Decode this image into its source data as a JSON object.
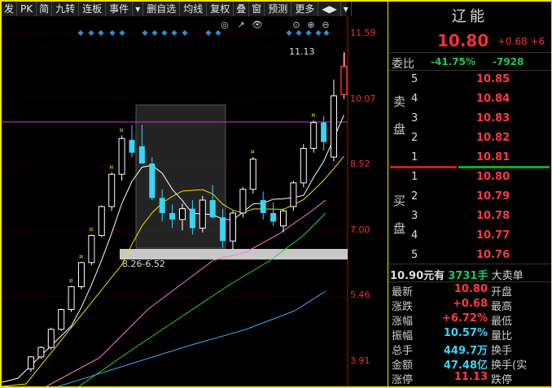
{
  "toolbar": {
    "items": [
      "发",
      "PK",
      "简",
      "九转",
      "连板",
      "事件",
      "▾",
      "删自选",
      "均线",
      "复权",
      "叠",
      "窗",
      "预测",
      "更多",
      "◀▶",
      "▾"
    ]
  },
  "chart": {
    "y_ticks": [
      "11.59",
      "10.07",
      "8.52",
      "7.00",
      "5.46",
      "3.91"
    ],
    "high_label": "11.13",
    "range_label": "8.26-6.52",
    "colors": {
      "up": "#ff3b3b",
      "down": "#38d5f5",
      "ma5": "#ffffff",
      "ma10": "#f2e100",
      "ma20": "#f77fd7",
      "ma60": "#26d92f",
      "ma120": "#3fa7ff",
      "hline": "#c63cc6"
    },
    "controls": [
      "◎",
      "↗",
      "👁",
      "⊙",
      "⊕",
      "⊖"
    ],
    "candles": [
      {
        "o": 3.78,
        "h": 4.08,
        "l": 3.71,
        "c": 4.06
      },
      {
        "o": 4.06,
        "h": 4.31,
        "l": 4.02,
        "c": 4.28
      },
      {
        "o": 4.28,
        "h": 4.74,
        "l": 4.23,
        "c": 4.7
      },
      {
        "o": 4.7,
        "h": 5.18,
        "l": 4.66,
        "c": 5.16
      },
      {
        "o": 5.16,
        "h": 5.71,
        "l": 5.1,
        "c": 5.69
      },
      {
        "o": 5.69,
        "h": 6.27,
        "l": 5.63,
        "c": 6.25
      },
      {
        "o": 6.25,
        "h": 6.9,
        "l": 6.19,
        "c": 6.88
      },
      {
        "o": 6.88,
        "h": 7.58,
        "l": 6.84,
        "c": 7.55
      },
      {
        "o": 7.55,
        "h": 8.34,
        "l": 7.45,
        "c": 8.3
      },
      {
        "o": 8.3,
        "h": 9.2,
        "l": 8.15,
        "c": 9.13
      },
      {
        "o": 9.1,
        "h": 9.45,
        "l": 8.7,
        "c": 8.8
      },
      {
        "o": 8.95,
        "h": 9.45,
        "l": 8.62,
        "c": 8.55
      },
      {
        "o": 8.55,
        "h": 8.7,
        "l": 7.7,
        "c": 7.75
      },
      {
        "o": 7.75,
        "h": 7.95,
        "l": 7.2,
        "c": 7.4
      },
      {
        "o": 7.4,
        "h": 7.6,
        "l": 7.05,
        "c": 7.25
      },
      {
        "o": 7.25,
        "h": 7.62,
        "l": 7.0,
        "c": 7.5
      },
      {
        "o": 7.5,
        "h": 7.7,
        "l": 6.9,
        "c": 7.05
      },
      {
        "o": 7.05,
        "h": 7.8,
        "l": 6.95,
        "c": 7.7
      },
      {
        "o": 7.7,
        "h": 8.05,
        "l": 7.28,
        "c": 7.3
      },
      {
        "o": 7.3,
        "h": 7.5,
        "l": 6.6,
        "c": 6.75
      },
      {
        "o": 6.75,
        "h": 7.45,
        "l": 6.55,
        "c": 7.4
      },
      {
        "o": 7.4,
        "h": 8.0,
        "l": 7.3,
        "c": 7.95
      },
      {
        "o": 7.95,
        "h": 8.7,
        "l": 7.85,
        "c": 8.65
      },
      {
        "o": 7.7,
        "h": 7.9,
        "l": 7.25,
        "c": 7.4
      },
      {
        "o": 7.4,
        "h": 7.65,
        "l": 7.1,
        "c": 7.2
      },
      {
        "o": 7.1,
        "h": 7.5,
        "l": 6.95,
        "c": 7.45
      },
      {
        "o": 7.55,
        "h": 8.15,
        "l": 7.45,
        "c": 8.1
      },
      {
        "o": 8.1,
        "h": 9.0,
        "l": 8.0,
        "c": 8.9
      },
      {
        "o": 8.9,
        "h": 9.55,
        "l": 8.8,
        "c": 9.5
      },
      {
        "o": 9.5,
        "h": 9.65,
        "l": 8.85,
        "c": 9.05
      },
      {
        "o": 8.7,
        "h": 10.5,
        "l": 8.6,
        "c": 10.12
      },
      {
        "o": 10.15,
        "h": 11.13,
        "l": 10.05,
        "c": 10.8
      }
    ],
    "limit_up_marks": [
      4,
      5,
      6,
      8,
      9,
      22,
      28
    ]
  },
  "panel": {
    "name": "辽能",
    "price": "10.80",
    "change": "+0.68",
    "change_pct_short": "+6",
    "weibi": {
      "label": "委比",
      "pct": "-41.75%",
      "diff": "-7928"
    },
    "sell_label": [
      "卖",
      "盘"
    ],
    "buy_label": [
      "买",
      "盘"
    ],
    "sells": [
      {
        "i": "5",
        "p": "10.85"
      },
      {
        "i": "4",
        "p": "10.84"
      },
      {
        "i": "3",
        "p": "10.83"
      },
      {
        "i": "2",
        "p": "10.82"
      },
      {
        "i": "1",
        "p": "10.81"
      }
    ],
    "buys": [
      {
        "i": "1",
        "p": "10.80"
      },
      {
        "i": "2",
        "p": "10.79"
      },
      {
        "i": "3",
        "p": "10.78"
      },
      {
        "i": "4",
        "p": "10.77"
      },
      {
        "i": "5",
        "p": "10.76"
      }
    ],
    "big_order": {
      "price": "10.90元有",
      "qty": "3731手",
      "desc": "大卖单"
    },
    "stats": [
      {
        "k": "最新",
        "v": "10.80",
        "k2": "开盘",
        "c": "red"
      },
      {
        "k": "涨跌",
        "v": "+0.68",
        "k2": "最高",
        "c": "red"
      },
      {
        "k": "涨幅",
        "v": "+6.72%",
        "k2": "最低",
        "c": "red"
      },
      {
        "k": "振幅",
        "v": "10.57%",
        "k2": "量比",
        "c": "cyan"
      },
      {
        "k": "总手",
        "v": "449.7万",
        "k2": "换手",
        "c": "cyan"
      },
      {
        "k": "金额",
        "v": "47.48亿",
        "k2": "换手(实",
        "c": "cyan"
      },
      {
        "k": "涨停",
        "v": "11.13",
        "k2": "跌停",
        "c": "red"
      }
    ]
  }
}
